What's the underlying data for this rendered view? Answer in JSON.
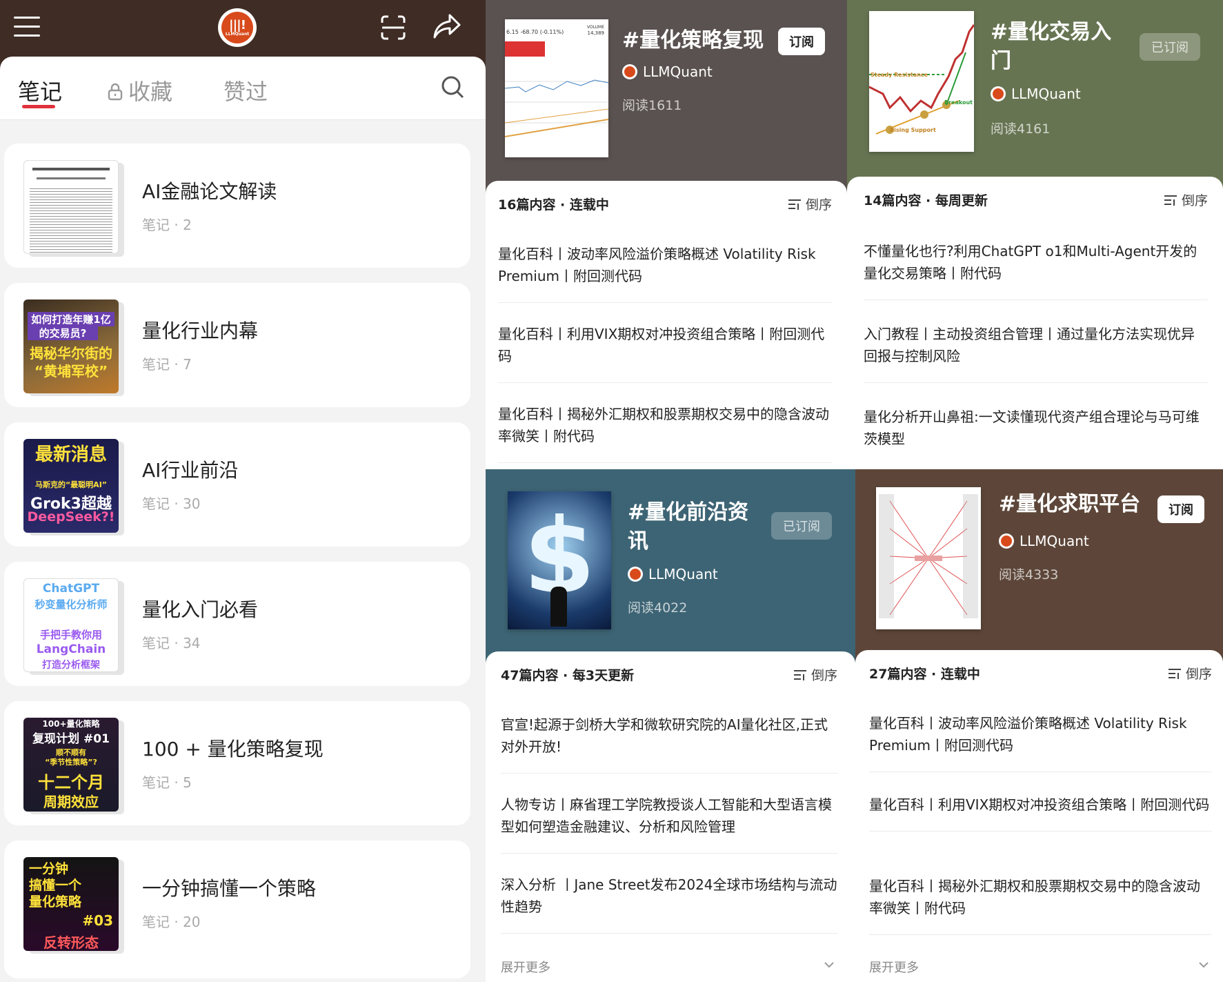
{
  "left": {
    "logo_text": "LLMQuant",
    "tabs": [
      {
        "label": "笔记"
      },
      {
        "label": "收藏"
      },
      {
        "label": "赞过"
      }
    ],
    "collections": [
      {
        "title": "AI金融论文解读",
        "sub": "笔记 · 2"
      },
      {
        "title": "量化行业内幕",
        "sub": "笔记 · 7",
        "thumb_text": [
          "如何打造年赚1亿",
          "的交易员?",
          "揭秘华尔街的",
          "“黄埔军校”"
        ]
      },
      {
        "title": "AI行业前沿",
        "sub": "笔记 · 30",
        "thumb_text": [
          "最新消息",
          "马斯克的“最聪明AI”",
          "Grok3超越",
          "DeepSeek?!"
        ]
      },
      {
        "title": "量化入门必看",
        "sub": "笔记 · 34",
        "thumb_text": [
          "ChatGPT",
          "秒变量化分析师",
          "手把手教你用",
          "LangChain",
          "打造分析框架"
        ]
      },
      {
        "title": "100 + 量化策略复现",
        "sub": "笔记 · 5",
        "thumb_text": [
          "100+量化策略",
          "复现计划 #01",
          "顺不顺有",
          "“季节性策略”?",
          "十二个月",
          "周期效应"
        ]
      },
      {
        "title": "一分钟搞懂一个策略",
        "sub": "笔记 · 20",
        "thumb_text": [
          "一分钟",
          "搞懂一个",
          "量化策略",
          "#03",
          "反转形态"
        ]
      }
    ]
  },
  "cards": [
    {
      "title": "#量化策略复现",
      "author": "LLMQuant",
      "reads": "阅读1611",
      "button": "订阅",
      "meta": "16篇内容 · 连载中",
      "order": "倒序",
      "articles": [
        "量化百科丨波动率风险溢价策略概述 Volatility Risk Premium丨附回测代码",
        "量化百科丨利用VIX期权对冲投资组合策略丨附回测代码",
        "量化百科丨揭秘外汇期权和股票期权交易中的隐含波动率微笑丨附代码"
      ],
      "cover_text": [
        "6.15 -68.70 (-0.11%)",
        "VOLUME",
        "14,389"
      ]
    },
    {
      "title": "#量化交易入门",
      "author": "LLMQuant",
      "reads": "阅读4161",
      "button": "已订阅",
      "meta": "14篇内容 · 每周更新",
      "order": "倒序",
      "articles": [
        "不懂量化也行?利用ChatGPT o1和Multi-Agent开发的量化交易策略丨附代码",
        "入门教程丨主动投资组合管理丨通过量化方法实现优异回报与控制风险",
        "量化分析开山鼻祖:一文读懂现代资产组合理论与马可维茨模型"
      ],
      "cover_text": [
        "Steady Resistance",
        "Breakout",
        "Rising Support"
      ]
    },
    {
      "title": "#量化前沿资讯",
      "author": "LLMQuant",
      "reads": "阅读4022",
      "button": "已订阅",
      "meta": "47篇内容 · 每3天更新",
      "order": "倒序",
      "articles": [
        "官宣!起源于剑桥大学和微软研究院的AI量化社区,正式对外开放!",
        "人物专访丨麻省理工学院教授谈人工智能和大型语言模型如何塑造金融建议、分析和风险管理",
        "深入分析 丨Jane Street发布2024全球市场结构与流动性趋势"
      ],
      "expand": "展开更多"
    },
    {
      "title": "#量化求职平台",
      "author": "LLMQuant",
      "reads": "阅读4333",
      "button": "订阅",
      "meta": "27篇内容 · 连载中",
      "order": "倒序",
      "articles": [
        "量化百科丨波动率风险溢价策略概述 Volatility Risk Premium丨附回测代码",
        "量化百科丨利用VIX期权对冲投资组合策略丨附回测代码",
        "量化百科丨揭秘外汇期权和股票期权交易中的隐含波动率微笑丨附代码"
      ],
      "expand": "展开更多"
    }
  ],
  "colors": {
    "left_header": "#3f2c24",
    "card1": "#5a5250",
    "card2": "#677452",
    "card3": "#3d6474",
    "card4": "#5d4639",
    "tab_accent": "#e0303a"
  },
  "icons": [
    "menu-icon",
    "logo",
    "scan-icon",
    "share-icon",
    "lock-icon",
    "search-icon",
    "sort-icon",
    "chevron-down-icon"
  ]
}
